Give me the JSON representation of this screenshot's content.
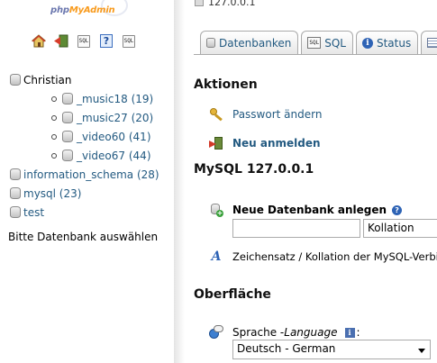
{
  "nav": {
    "logo_part1": "php",
    "logo_part2": "MyAdmin",
    "icons": [
      "home-icon",
      "logout-icon",
      "sql-query-icon",
      "help-icon",
      "sql-docs-icon"
    ],
    "sql_icon_text": "SQL",
    "help_icon_text": "?",
    "tree": [
      {
        "label": "Christian",
        "children": [
          {
            "label": "_music18 (19)"
          },
          {
            "label": "_music27 (20)"
          },
          {
            "label": "_video60 (41)"
          },
          {
            "label": "_video67 (44)"
          }
        ]
      },
      {
        "label": "information_schema (28)"
      },
      {
        "label": "mysql (23)"
      },
      {
        "label": "test"
      }
    ],
    "hint": "Bitte Datenbank auswählen"
  },
  "main": {
    "server_label": "127.0.0.1",
    "tabs": [
      {
        "label": "Datenbanken",
        "icon": "database-icon"
      },
      {
        "label": "SQL",
        "icon": "sql-icon"
      },
      {
        "label": "Status",
        "icon": "info-icon"
      },
      {
        "label": "",
        "icon": "list-icon"
      }
    ],
    "tab_sql_icon_text": "SQL",
    "tab_info_icon_text": "i",
    "actions_heading": "Aktionen",
    "change_password": "Passwort ändern",
    "relogin": "Neu anmelden",
    "mysql_heading": "MySQL 127.0.0.1",
    "new_db_label": "Neue Datenbank anlegen",
    "help_icon_text": "?",
    "new_db_value": "",
    "collation_value": "Kollation",
    "charset_icon_text": "A",
    "charset_text": "Zeichensatz / Kollation der MySQL-Verbindung",
    "ui_heading": "Oberfläche",
    "language_label": "Sprache - ",
    "language_label_en": "Language",
    "info_icon_text": "i",
    "language_colon": ":",
    "language_value": "Deutsch - German"
  }
}
